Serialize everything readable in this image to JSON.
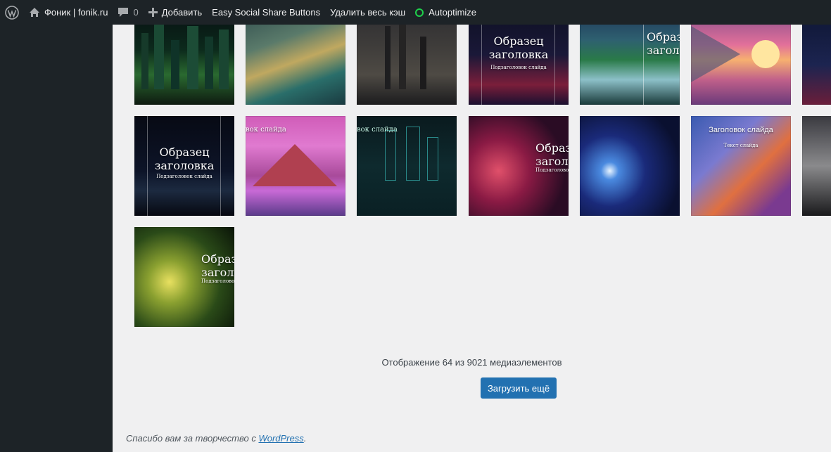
{
  "adminbar": {
    "wp_logo_icon": "wordpress-logo-icon",
    "site_name": "Фоник | fonik.ru",
    "comments_count": "0",
    "add_new_label": "Добавить",
    "plugin_share_label": "Easy Social Share Buttons",
    "clear_cache_label": "Удалить весь кэш",
    "autoptimize_label": "Autoptimize",
    "status_color": "#1ed14b"
  },
  "media": {
    "items": [
      {
        "name": "media-item-city-green",
        "caption": "",
        "sub": ""
      },
      {
        "name": "media-item-teal-valley",
        "caption": "",
        "sub": ""
      },
      {
        "name": "media-item-dark-castle",
        "caption": "",
        "sub": ""
      },
      {
        "name": "media-item-city-night",
        "caption": "Образец\nзаголовка",
        "sub": "Подзаголовок слайда"
      },
      {
        "name": "media-item-waterfall",
        "caption": "Образец\nзаголовка",
        "sub": ""
      },
      {
        "name": "media-item-sunset-sea",
        "caption": "",
        "sub": ""
      },
      {
        "name": "media-item-city-edge",
        "caption": "",
        "sub": ""
      },
      {
        "name": "media-item-city-skyline",
        "caption": "Образец\nзаголовка",
        "sub": "Подзаголовок слайда"
      },
      {
        "name": "media-item-pink-mountains",
        "caption": "вок слайда",
        "sub": ""
      },
      {
        "name": "media-item-circuit-city",
        "caption": "вок слайда",
        "sub": ""
      },
      {
        "name": "media-item-red-fractal",
        "caption": "Образец\nзаголовка",
        "sub": "Подзаголовок слайда"
      },
      {
        "name": "media-item-blue-spiral",
        "caption": "",
        "sub": ""
      },
      {
        "name": "media-item-nebula",
        "caption": "Заголовок слайда",
        "sub": "Текст слайда"
      },
      {
        "name": "media-item-tree-edge",
        "caption": "",
        "sub": ""
      },
      {
        "name": "media-item-green-fractal",
        "caption": "Образе\nзаголо",
        "sub": "Подзаголовок слайд"
      }
    ],
    "count_text": "Отображение 64 из 9021 медиаэлементов",
    "load_more_label": "Загрузить ещё",
    "accent": "#2271b1"
  },
  "footer": {
    "thanks_text": "Спасибо вам за творчество с ",
    "link_text": "WordPress",
    "period": "."
  }
}
